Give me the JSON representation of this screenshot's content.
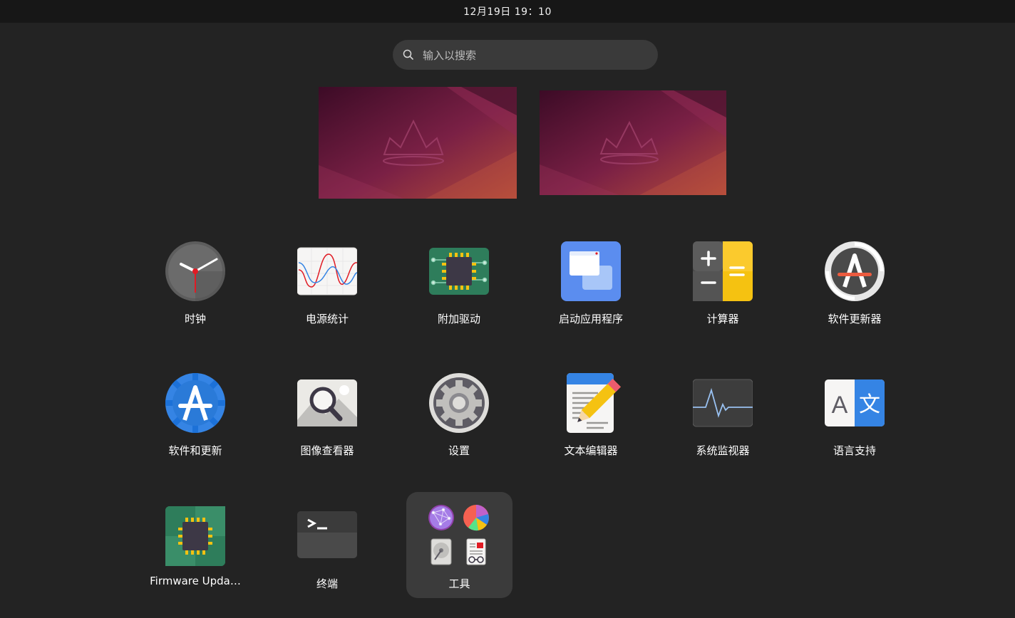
{
  "topbar": {
    "datetime": "12月19日  19：10"
  },
  "search": {
    "placeholder": "输入以搜索"
  },
  "apps": [
    {
      "label": "时钟",
      "icon": "clock-icon"
    },
    {
      "label": "电源统计",
      "icon": "power-statistics-icon"
    },
    {
      "label": "附加驱动",
      "icon": "additional-drivers-icon"
    },
    {
      "label": "启动应用程序",
      "icon": "startup-applications-icon"
    },
    {
      "label": "计算器",
      "icon": "calculator-icon"
    },
    {
      "label": "软件更新器",
      "icon": "software-updater-icon"
    },
    {
      "label": "软件和更新",
      "icon": "software-properties-icon"
    },
    {
      "label": "图像查看器",
      "icon": "image-viewer-icon"
    },
    {
      "label": "设置",
      "icon": "settings-gear-icon"
    },
    {
      "label": "文本编辑器",
      "icon": "text-editor-icon"
    },
    {
      "label": "系统监视器",
      "icon": "system-monitor-icon"
    },
    {
      "label": "语言支持",
      "icon": "language-support-icon"
    },
    {
      "label": "Firmware Upda…",
      "icon": "firmware-updater-icon"
    },
    {
      "label": "终端",
      "icon": "terminal-icon"
    }
  ],
  "folder": {
    "label": "工具",
    "icons": [
      "network-globe-icon",
      "disk-usage-pie-icon",
      "disks-icon",
      "document-viewer-icon"
    ]
  },
  "colors": {
    "background": "#232323",
    "topbar": "#171717",
    "search_bg": "#3a3a3a",
    "folder_bg": "#3b3b3b"
  }
}
